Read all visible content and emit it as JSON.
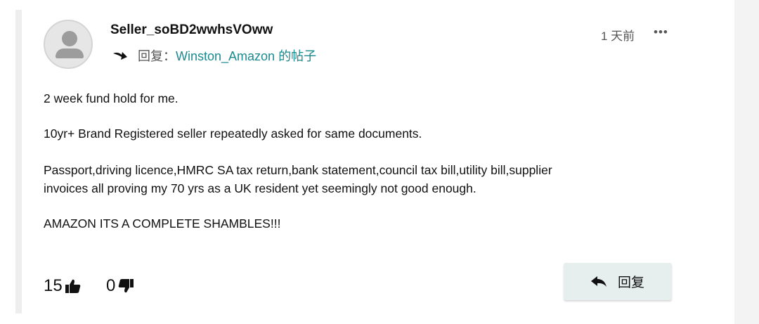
{
  "post": {
    "author": "Seller_soBD2wwhsVOww",
    "reply_prefix": "回复：",
    "reply_target": "Winston_Amazon 的帖子",
    "timestamp": "1 天前",
    "more_label": "•••",
    "paragraphs": [
      "2 week fund hold for me.",
      "10yr+ Brand Registered seller repeatedly asked for same documents.",
      "Passport,driving licence,HMRC SA tax return,bank statement,council tax bill,utility bill,supplier",
      "invoices all proving my 70 yrs as a UK resident yet seemingly not good enough.",
      "AMAZON ITS A COMPLETE SHAMBLES!!!"
    ]
  },
  "votes": {
    "up_count": "15",
    "down_count": "0"
  },
  "actions": {
    "reply_label": "回复"
  },
  "icons": {
    "avatar": "user-silhouette-icon",
    "reply_arrow": "reply-arrow-icon",
    "more": "more-dots-icon",
    "thumbs_up": "thumbs-up-icon",
    "thumbs_down": "thumbs-down-icon",
    "reply_button": "reply-icon"
  },
  "colors": {
    "link": "#1a8a8f",
    "button_bg": "#e6eeee"
  }
}
